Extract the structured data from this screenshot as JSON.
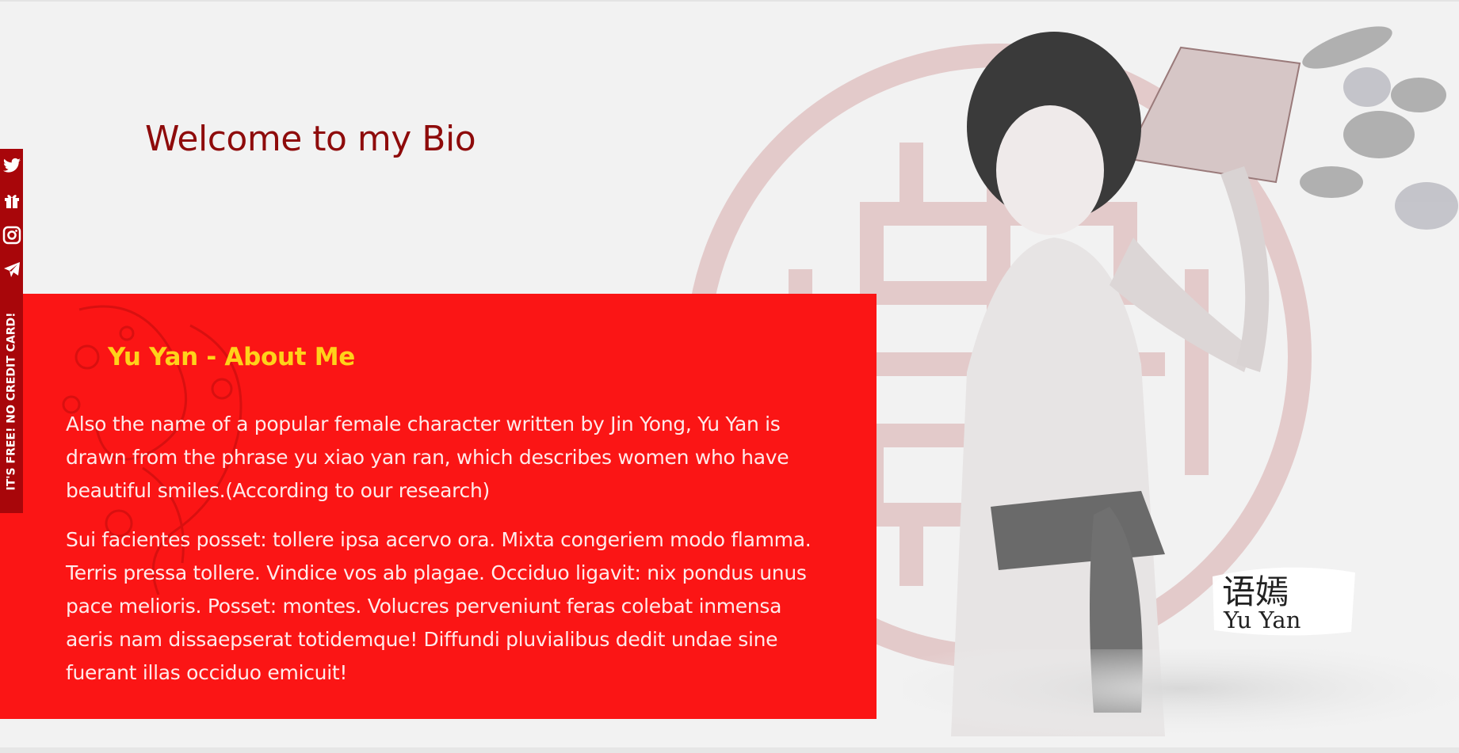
{
  "header": {
    "title": "Welcome to my Bio"
  },
  "about": {
    "heading": "Yu Yan - About Me",
    "paragraphs": [
      "Also the name of a popular female character written by Jin Yong, Yu Yan is drawn from the phrase yu xiao yan ran, which describes women who have beautiful smiles.(According to our research)",
      "Sui facientes posset: tollere ipsa acervo ora. Mixta congeriem modo flamma. Terris pressa tollere. Vindice vos ab plagae. Occiduo ligavit: nix pondus unus pace melioris. Posset: montes. Volucres perveniunt feras colebat inmensa aeris nam dissaepserat totidemque! Diffundi pluvialibus dedit undae sine fuerant illas occiduo emicuit!"
    ]
  },
  "social_rail": {
    "buttons": [
      {
        "icon": "twitter-icon"
      },
      {
        "icon": "gift-icon"
      },
      {
        "icon": "instagram-icon"
      },
      {
        "icon": "send-icon"
      }
    ],
    "promo": "IT'S FREE! NO CREDIT CARD!"
  },
  "signature": {
    "chinese": "语嫣",
    "name": "Yu Yan"
  },
  "colors": {
    "title": "#8e0b0b",
    "panel": "#fb1515",
    "heading": "#ffd21a",
    "rail": "#a8060a",
    "background": "#f2f2f2"
  }
}
